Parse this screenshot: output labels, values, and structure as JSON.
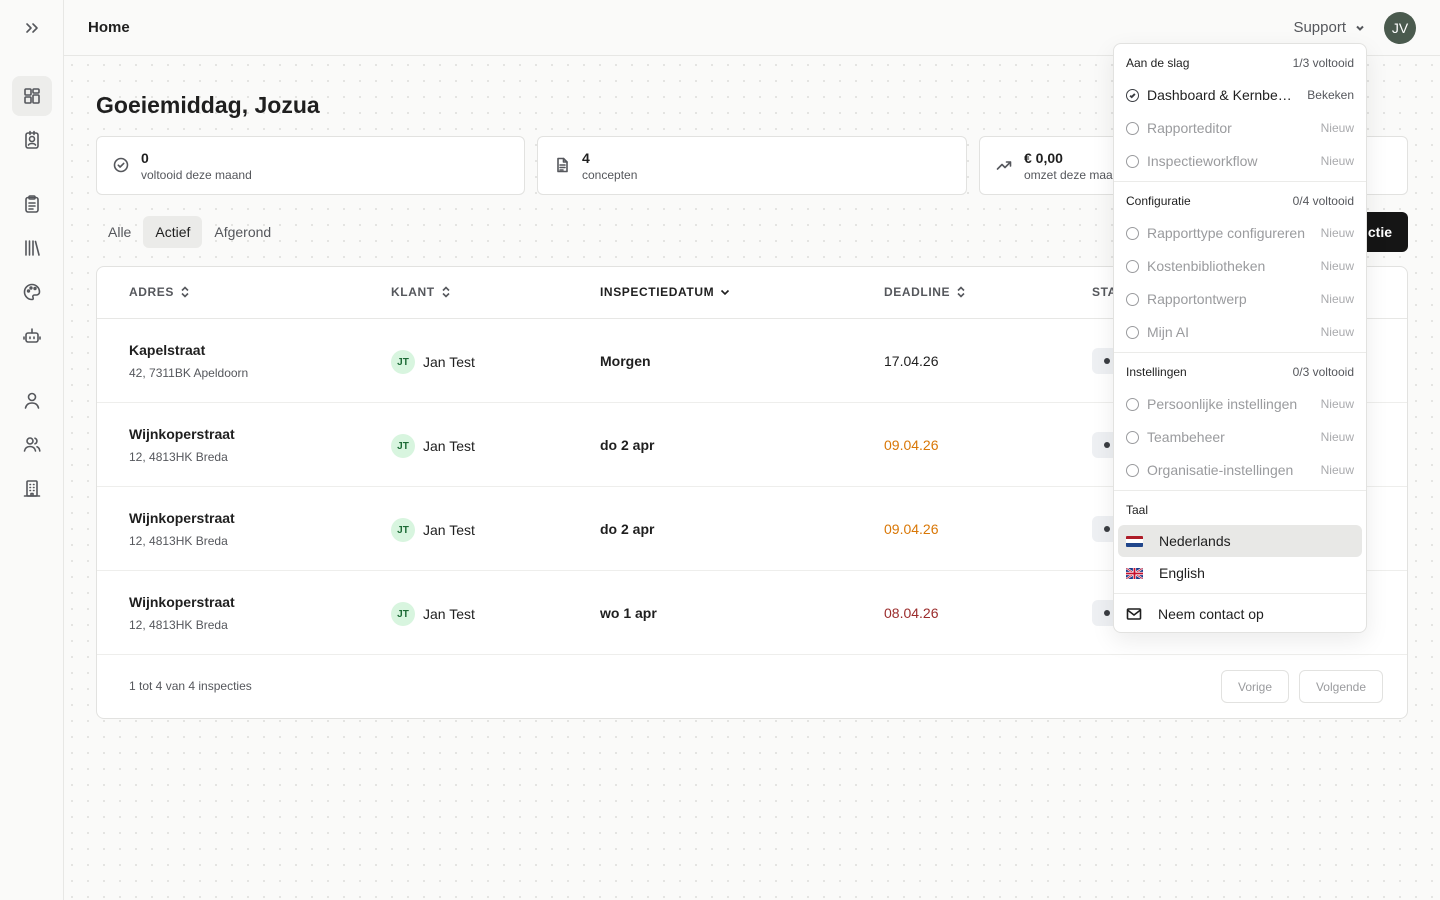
{
  "header": {
    "title": "Home",
    "support_label": "Support",
    "avatar_initials": "JV"
  },
  "sidebar": {
    "items": [
      {
        "icon": "dashboard-icon"
      },
      {
        "icon": "contact-card-icon"
      },
      {
        "icon": "clipboard-icon"
      },
      {
        "icon": "library-icon"
      },
      {
        "icon": "palette-icon"
      },
      {
        "icon": "robot-icon"
      },
      {
        "icon": "user-icon"
      },
      {
        "icon": "users-icon"
      },
      {
        "icon": "building-icon"
      }
    ]
  },
  "greeting": "Goeiemiddag, Jozua",
  "stats": [
    {
      "value": "0",
      "label": "voltooid deze maand",
      "icon": "check-circle-icon"
    },
    {
      "value": "4",
      "label": "concepten",
      "icon": "document-icon"
    },
    {
      "value": "€ 0,00",
      "label": "omzet deze maa",
      "icon": "trending-up-icon"
    }
  ],
  "tabs": [
    "Alle",
    "Actief",
    "Afgerond"
  ],
  "active_tab": "Actief",
  "new_button_label": "ctie",
  "table": {
    "columns": [
      "ADRES",
      "KLANT",
      "INSPECTIEDATUM",
      "DEADLINE",
      "STA"
    ],
    "rows": [
      {
        "street": "Kapelstraat",
        "city": "42, 7311BK Apeldoorn",
        "client_initials": "JT",
        "client": "Jan Test",
        "date": "Morgen",
        "deadline": "17.04.26",
        "deadline_color": "#1f1f1f"
      },
      {
        "street": "Wijnkoperstraat",
        "city": "12, 4813HK Breda",
        "client_initials": "JT",
        "client": "Jan Test",
        "date": "do 2 apr",
        "deadline": "09.04.26",
        "deadline_color": "#d97706"
      },
      {
        "street": "Wijnkoperstraat",
        "city": "12, 4813HK Breda",
        "client_initials": "JT",
        "client": "Jan Test",
        "date": "do 2 apr",
        "deadline": "09.04.26",
        "deadline_color": "#d97706"
      },
      {
        "street": "Wijnkoperstraat",
        "city": "12, 4813HK Breda",
        "client_initials": "JT",
        "client": "Jan Test",
        "date": "wo 1 apr",
        "deadline": "08.04.26",
        "deadline_color": "#9b2c2c"
      }
    ],
    "footer_text": "1 tot 4 van 4 inspecties",
    "prev_label": "Vorige",
    "next_label": "Volgende"
  },
  "dropdown": {
    "sections": [
      {
        "title": "Aan de slag",
        "count": "1/3 voltooid",
        "items": [
          {
            "label": "Dashboard & Kernbegrippen",
            "tag": "Bekeken",
            "done": true
          },
          {
            "label": "Rapporteditor",
            "tag": "Nieuw",
            "done": false
          },
          {
            "label": "Inspectieworkflow",
            "tag": "Nieuw",
            "done": false
          }
        ]
      },
      {
        "title": "Configuratie",
        "count": "0/4 voltooid",
        "items": [
          {
            "label": "Rapporttype configureren",
            "tag": "Nieuw",
            "done": false
          },
          {
            "label": "Kostenbibliotheken",
            "tag": "Nieuw",
            "done": false
          },
          {
            "label": "Rapportontwerp",
            "tag": "Nieuw",
            "done": false
          },
          {
            "label": "Mijn AI",
            "tag": "Nieuw",
            "done": false
          }
        ]
      },
      {
        "title": "Instellingen",
        "count": "0/3 voltooid",
        "items": [
          {
            "label": "Persoonlijke instellingen",
            "tag": "Nieuw",
            "done": false
          },
          {
            "label": "Teambeheer",
            "tag": "Nieuw",
            "done": false
          },
          {
            "label": "Organisatie-instellingen",
            "tag": "Nieuw",
            "done": false
          }
        ]
      }
    ],
    "language_title": "Taal",
    "languages": [
      {
        "label": "Nederlands",
        "selected": true,
        "flag": "nl-flag-icon"
      },
      {
        "label": "English",
        "selected": false,
        "flag": "gb-flag-icon"
      }
    ],
    "contact_label": "Neem contact op"
  }
}
